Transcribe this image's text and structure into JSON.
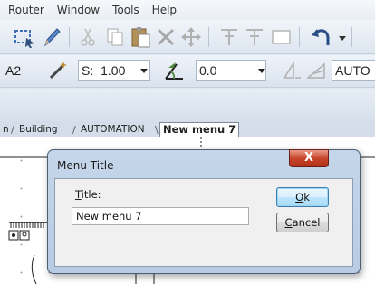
{
  "menubar": {
    "items": [
      "Router",
      "Window",
      "Tools",
      "Help"
    ]
  },
  "toolbar1": {
    "icons": [
      "select-rect-icon",
      "pencil-icon",
      "cut-icon",
      "copy-icon",
      "paste-icon",
      "delete-icon",
      "move-icon",
      "text-style-icon",
      "text-style-2-icon",
      "rectangle-icon",
      "undo-icon"
    ]
  },
  "toolbar2": {
    "layer_value": "A2",
    "scale_label": "S:",
    "scale_value": "1.00",
    "angle_value": "0.0",
    "auto_value": "AUTO"
  },
  "tabs": {
    "items": [
      "n",
      "Building",
      "AUTOMATION"
    ],
    "active": "New menu 7"
  },
  "dialog": {
    "title": "Menu Title",
    "close_label": "X",
    "field_label_underlined": "T",
    "field_label_rest": "itle:",
    "field_value": "New menu 7",
    "ok_underlined": "O",
    "ok_rest": "k",
    "cancel_underlined": "C",
    "cancel_rest": "ancel"
  },
  "colors": {
    "dialog_frame": "#b7cbe3",
    "close_button": "#c8452d",
    "default_button": "#bee6fd"
  }
}
